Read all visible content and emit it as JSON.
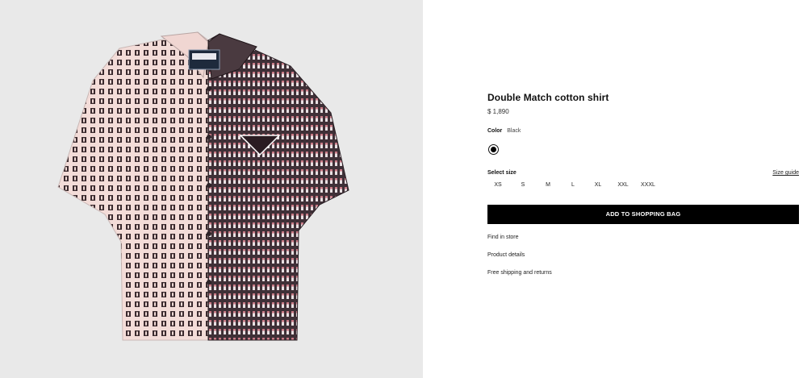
{
  "product": {
    "title": "Double Match cotton shirt",
    "price": "$ 1,890",
    "image_alt": "shirt-photo"
  },
  "color": {
    "label": "Color",
    "value": "Black",
    "swatch_color": "#000000"
  },
  "size": {
    "label": "Select size",
    "guide_label": "Size guide",
    "options": [
      "XS",
      "S",
      "M",
      "L",
      "XL",
      "XXL",
      "XXXL"
    ]
  },
  "actions": {
    "add_to_bag": "ADD TO SHOPPING BAG"
  },
  "links": {
    "find_in_store": "Find in store",
    "product_details": "Product details",
    "shipping": "Free shipping and returns"
  },
  "colors": {
    "image_background": "#e9e9e9",
    "shirt_left": "#f2d9d6",
    "shirt_right": "#4a3a40",
    "button_bg": "#000000"
  }
}
